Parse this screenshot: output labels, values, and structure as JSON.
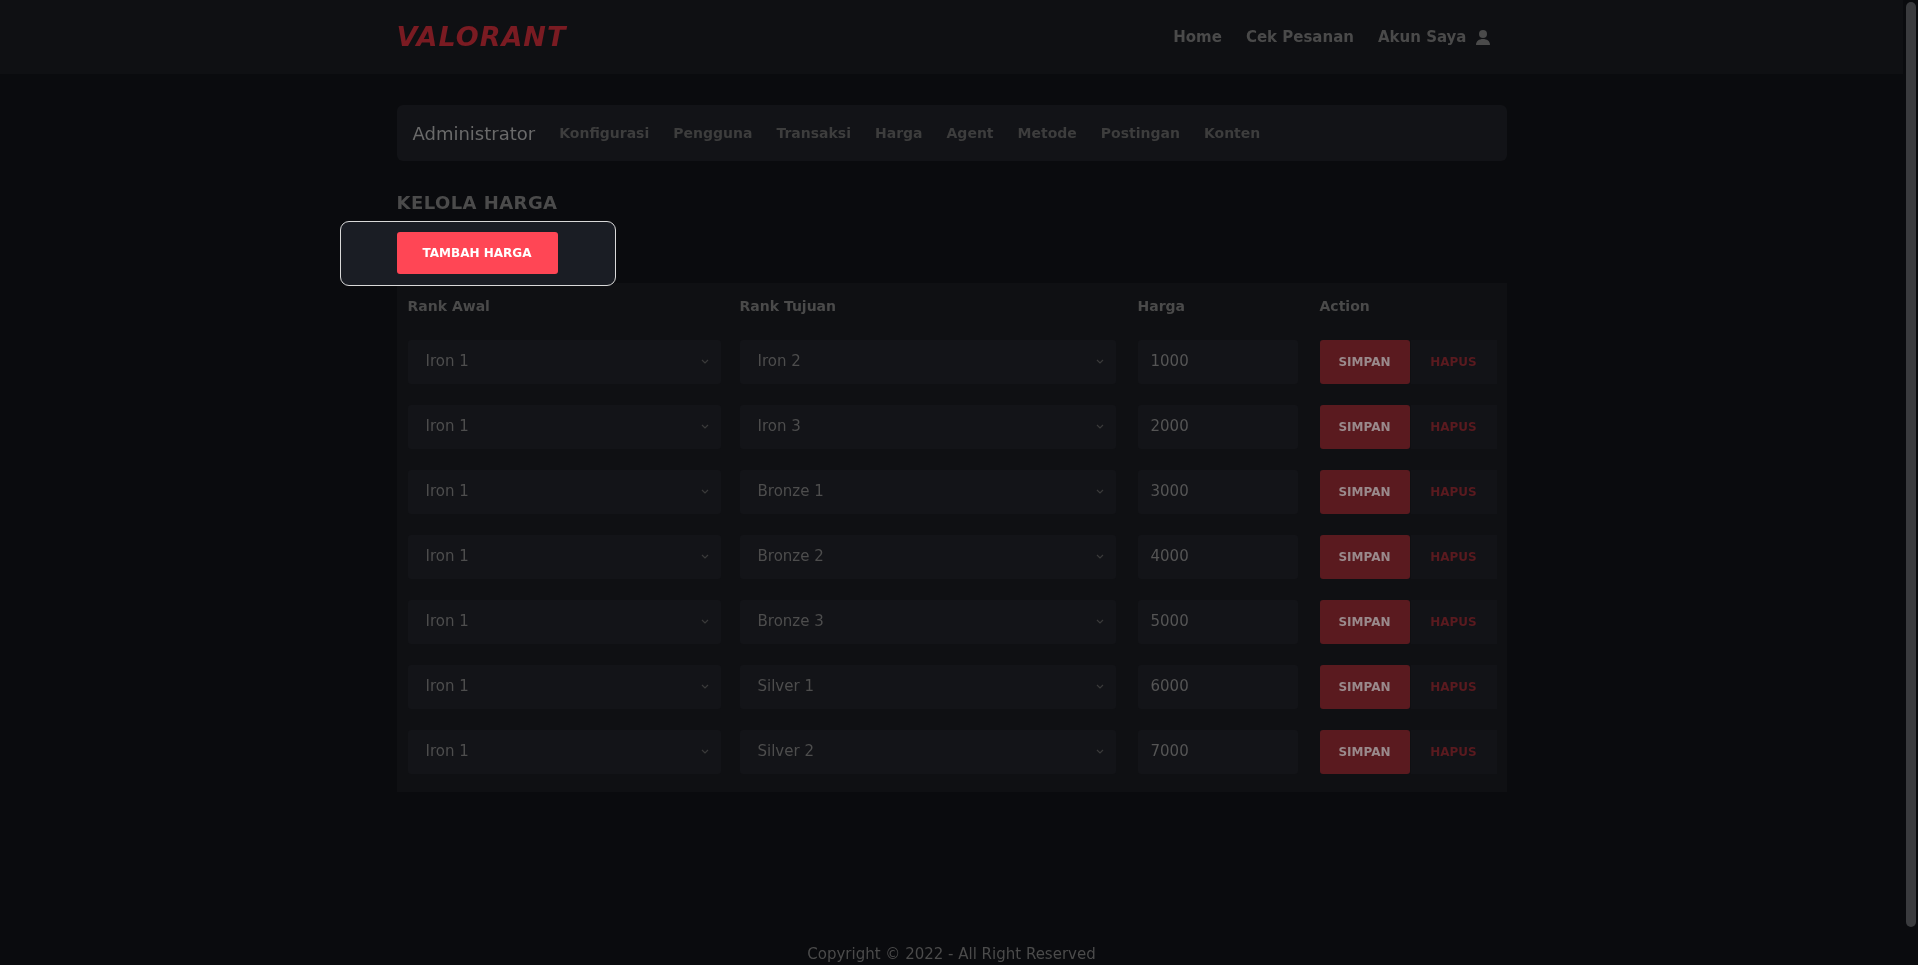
{
  "header": {
    "logo": "VALORANT",
    "nav": [
      "Home",
      "Cek Pesanan",
      "Akun Saya"
    ]
  },
  "admin_nav": {
    "title": "Administrator",
    "items": [
      "Konfigurasi",
      "Pengguna",
      "Transaksi",
      "Harga",
      "Agent",
      "Metode",
      "Postingan",
      "Konten"
    ]
  },
  "page_title": "KELOLA HARGA",
  "add_button": "TAMBAH HARGA",
  "table": {
    "columns": [
      "Rank Awal",
      "Rank Tujuan",
      "Harga",
      "Action"
    ],
    "rows": [
      {
        "rank_awal": "Iron 1",
        "rank_tujuan": "Iron 2",
        "harga": "1000",
        "save": "SIMPAN",
        "delete": "HAPUS"
      },
      {
        "rank_awal": "Iron 1",
        "rank_tujuan": "Iron 3",
        "harga": "2000",
        "save": "SIMPAN",
        "delete": "HAPUS"
      },
      {
        "rank_awal": "Iron 1",
        "rank_tujuan": "Bronze 1",
        "harga": "3000",
        "save": "SIMPAN",
        "delete": "HAPUS"
      },
      {
        "rank_awal": "Iron 1",
        "rank_tujuan": "Bronze 2",
        "harga": "4000",
        "save": "SIMPAN",
        "delete": "HAPUS"
      },
      {
        "rank_awal": "Iron 1",
        "rank_tujuan": "Bronze 3",
        "harga": "5000",
        "save": "SIMPAN",
        "delete": "HAPUS"
      },
      {
        "rank_awal": "Iron 1",
        "rank_tujuan": "Silver 1",
        "harga": "6000",
        "save": "SIMPAN",
        "delete": "HAPUS"
      },
      {
        "rank_awal": "Iron 1",
        "rank_tujuan": "Silver 2",
        "harga": "7000",
        "save": "SIMPAN",
        "delete": "HAPUS"
      }
    ]
  },
  "footer": "Copyright © 2022 - All Right Reserved"
}
